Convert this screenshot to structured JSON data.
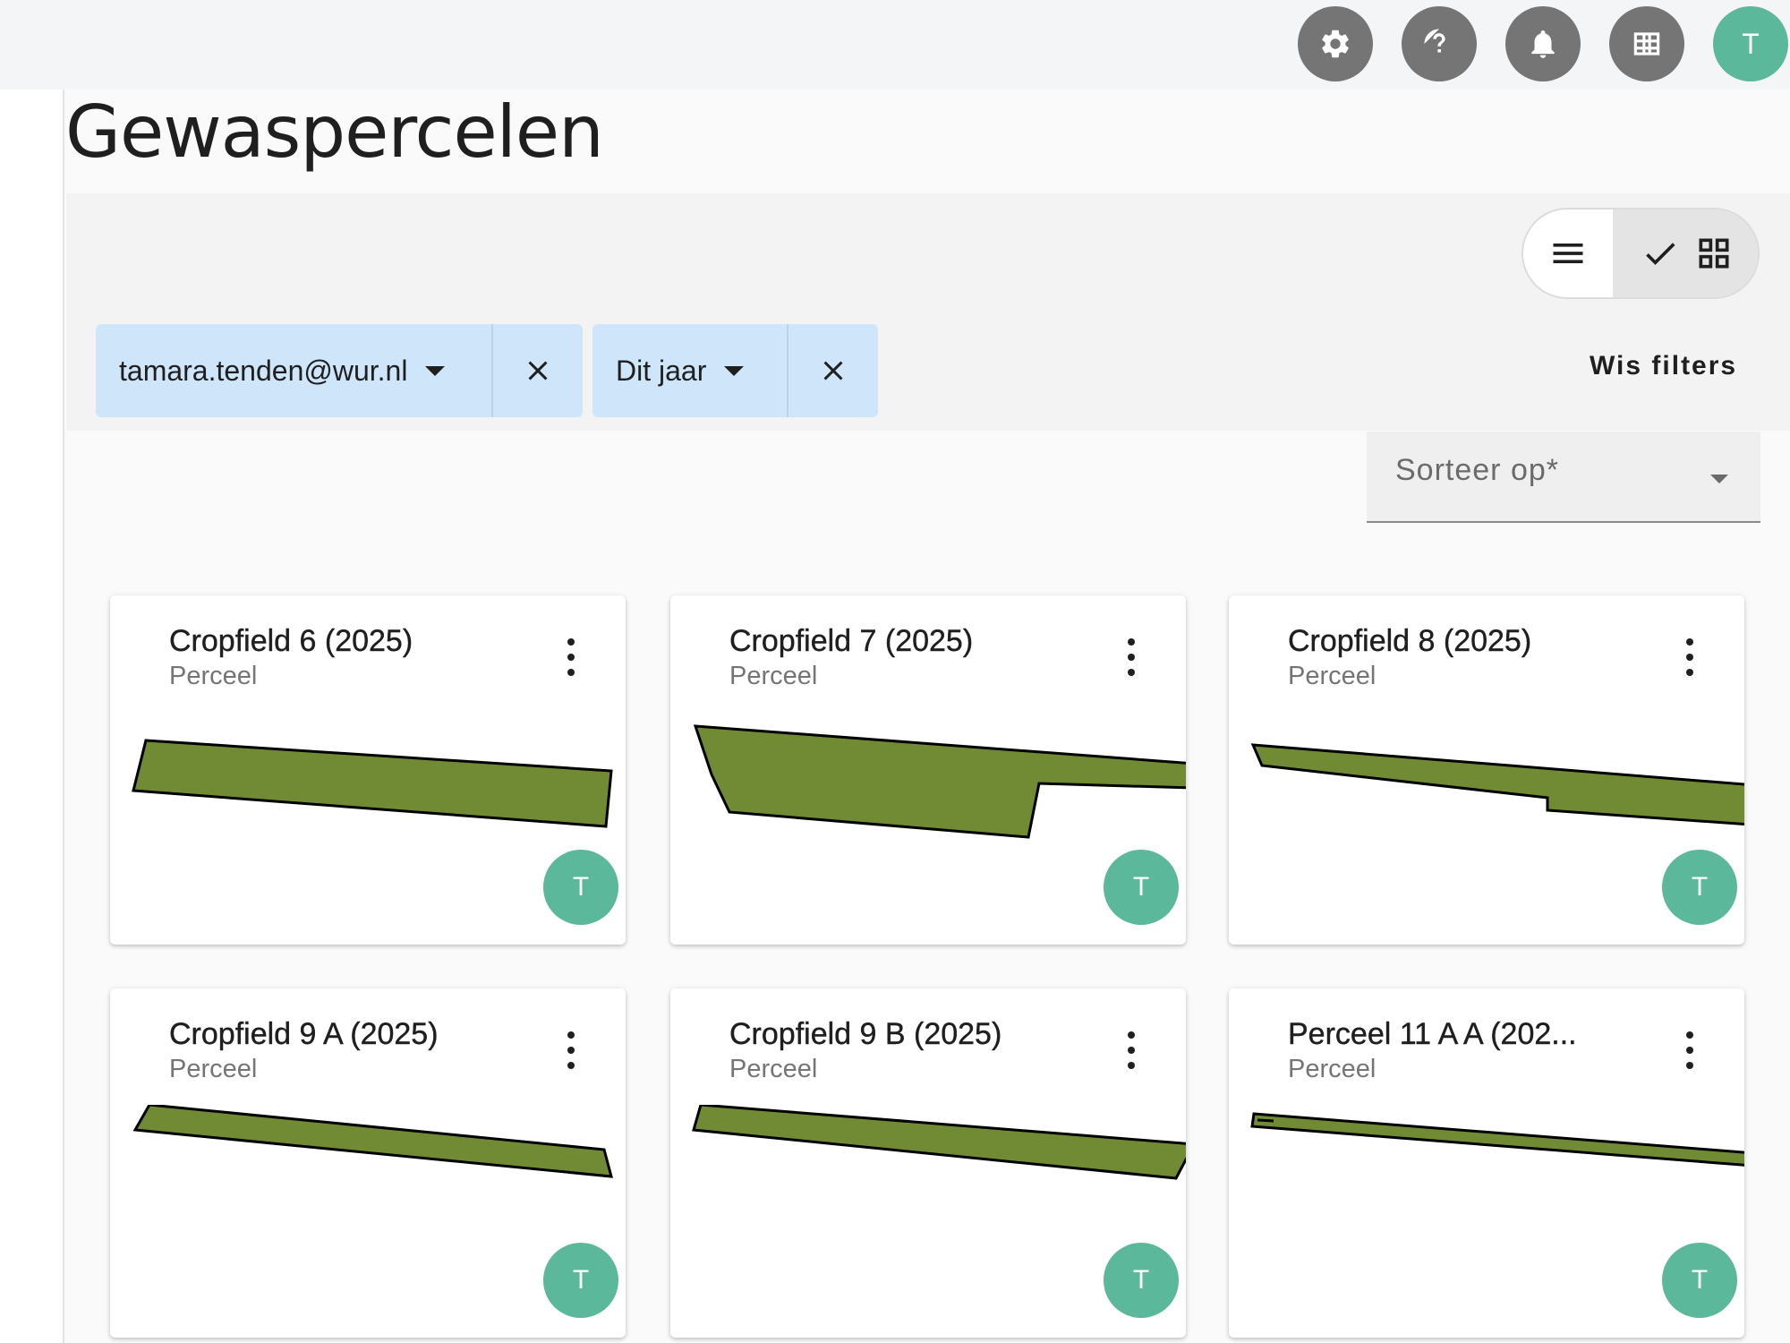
{
  "header": {
    "icons": [
      {
        "name": "settings-icon"
      },
      {
        "name": "help-icon"
      },
      {
        "name": "notifications-icon"
      },
      {
        "name": "apps-grid-icon"
      }
    ],
    "user_initial": "T"
  },
  "page": {
    "title": "Gewaspercelen"
  },
  "view_toggle": {
    "list_icon": "list-icon",
    "grid_icon": "grid-icon",
    "active": "grid"
  },
  "filters": {
    "chips": [
      {
        "label": "tamara.tenden@wur.nl"
      },
      {
        "label": "Dit jaar"
      }
    ],
    "clear_label": "Wis filters"
  },
  "sort": {
    "label": "Sorteer op*"
  },
  "cards": [
    {
      "title": "Cropfield 6 (2025)",
      "subtitle": "Perceel",
      "owner_initial": "T"
    },
    {
      "title": "Cropfield 7 (2025)",
      "subtitle": "Perceel",
      "owner_initial": "T"
    },
    {
      "title": "Cropfield 8 (2025)",
      "subtitle": "Perceel",
      "owner_initial": "T"
    },
    {
      "title": "Cropfield 9 A (2025)",
      "subtitle": "Perceel",
      "owner_initial": "T"
    },
    {
      "title": "Cropfield 9 B (2025)",
      "subtitle": "Perceel",
      "owner_initial": "T"
    },
    {
      "title": "Perceel 11 A A (202...",
      "subtitle": "Perceel",
      "owner_initial": "T"
    }
  ],
  "colors": {
    "field_fill": "#718b35",
    "avatar": "#5bb89a",
    "chip_bg": "#cfe6fa",
    "icon_button": "#757575"
  }
}
